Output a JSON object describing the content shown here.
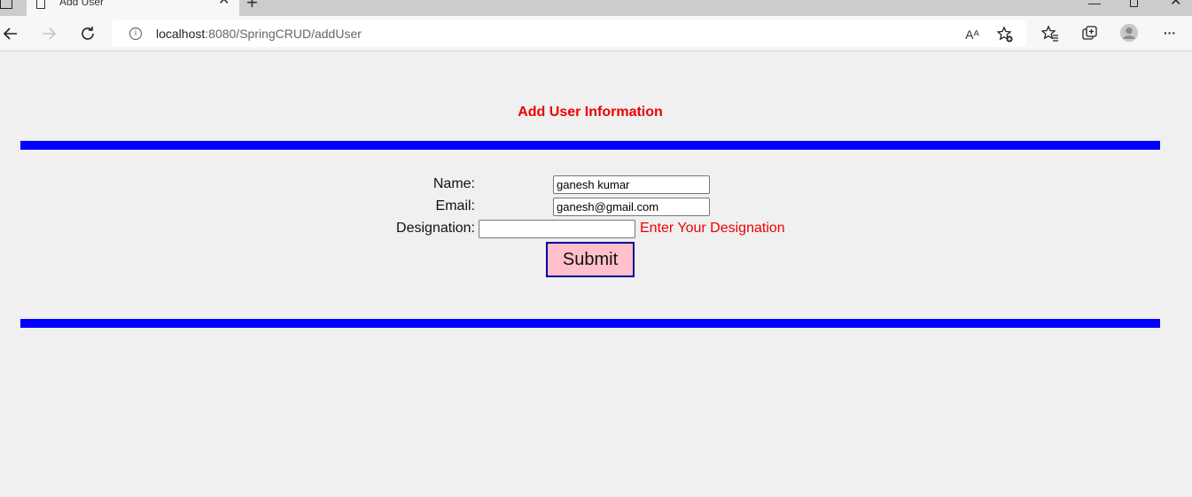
{
  "browser": {
    "tab_title": "Add User",
    "tab_close": "✕",
    "new_tab": "+",
    "url_host": "localhost",
    "url_rest": ":8080/SpringCRUD/addUser",
    "read_aloud": "Aᴬ",
    "win_minimize": "—",
    "win_close": "✕",
    "more": "···"
  },
  "page": {
    "title": "Add User Information",
    "form": {
      "name_label": "Name:",
      "name_value": "ganesh kumar",
      "email_label": "Email:",
      "email_value": "ganesh@gmail.com",
      "designation_label": "Designation:",
      "designation_value": "",
      "designation_error": "Enter Your Designation",
      "submit_label": "Submit"
    }
  },
  "colors": {
    "title": "#ee0000",
    "rule": "#0000ff",
    "error": "#ee0000",
    "submit_bg": "#ffc0cb",
    "submit_border": "#00009c",
    "page_bg": "#f0f0f0"
  },
  "icons": {
    "back": "arrow-left-icon",
    "forward": "arrow-right-icon",
    "refresh": "refresh-icon",
    "site_info": "info-icon",
    "read_aloud": "read-aloud-icon",
    "add_favorite": "star-plus-icon",
    "favorites": "favorites-icon",
    "collections": "collections-icon",
    "profile": "profile-icon",
    "more": "ellipsis-icon"
  }
}
